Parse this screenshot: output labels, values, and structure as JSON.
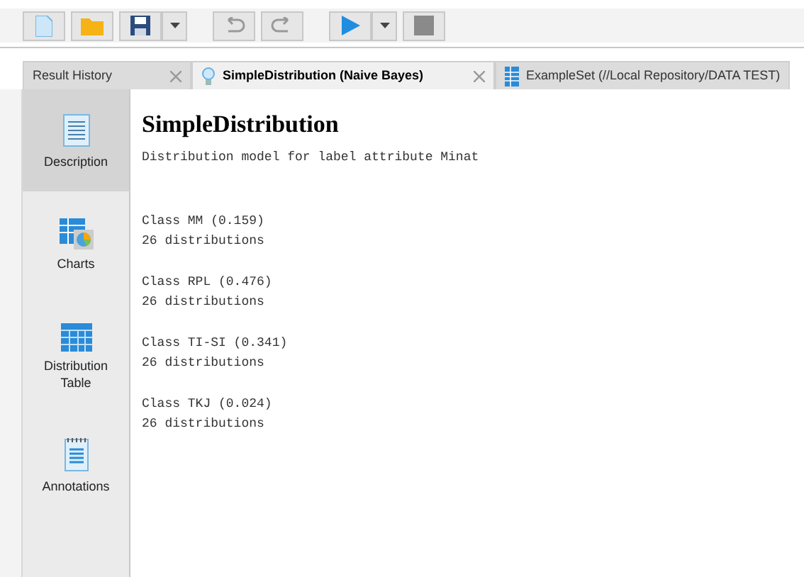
{
  "tabs": [
    {
      "label": "Result History",
      "selected": false,
      "closable": true,
      "kind": "history"
    },
    {
      "label": "SimpleDistribution (Naive Bayes)",
      "selected": true,
      "closable": true,
      "kind": "model"
    },
    {
      "label": "ExampleSet (//Local Repository/DATA TEST)",
      "selected": false,
      "closable": false,
      "kind": "data"
    }
  ],
  "sidebar": {
    "items": [
      {
        "label": "Description",
        "selected": true,
        "kind": "description"
      },
      {
        "label": "Charts",
        "selected": false,
        "kind": "charts"
      },
      {
        "label": "Distribution Table",
        "selected": false,
        "kind": "table"
      },
      {
        "label": "Annotations",
        "selected": false,
        "kind": "annotations"
      }
    ]
  },
  "content": {
    "title": "SimpleDistribution",
    "subtitle": "Distribution model for label attribute Minat",
    "classes": [
      {
        "name": "Class MM (0.159)",
        "detail": "26 distributions"
      },
      {
        "name": "Class RPL (0.476)",
        "detail": "26 distributions"
      },
      {
        "name": "Class TI-SI (0.341)",
        "detail": "26 distributions"
      },
      {
        "name": "Class TKJ (0.024)",
        "detail": "26 distributions"
      }
    ]
  }
}
